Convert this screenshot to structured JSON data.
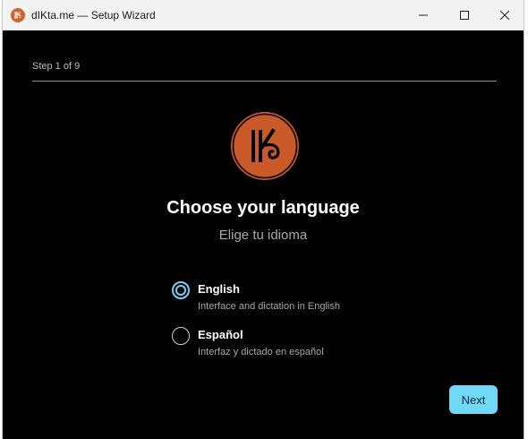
{
  "window": {
    "title": "dIKta.me — Setup Wizard",
    "controls": {
      "minimize": "minimize-icon",
      "maximize": "maximize-icon",
      "close": "close-icon"
    }
  },
  "wizard": {
    "step_label": "Step 1 of 9",
    "progress": {
      "current": 1,
      "total": 9
    },
    "heading": "Choose your language",
    "subheading": "Elige tu idioma",
    "logo": {
      "icon": "dikta-logo-icon",
      "color": "#c95a28"
    },
    "options": [
      {
        "label": "English",
        "description": "Interface and dictation in English",
        "selected": true
      },
      {
        "label": "Español",
        "description": "Interfaz y dictado en español",
        "selected": false
      }
    ],
    "next_label": "Next"
  },
  "colors": {
    "accent": "#6fd9f7",
    "background": "#000000",
    "brand": "#c95a28"
  }
}
